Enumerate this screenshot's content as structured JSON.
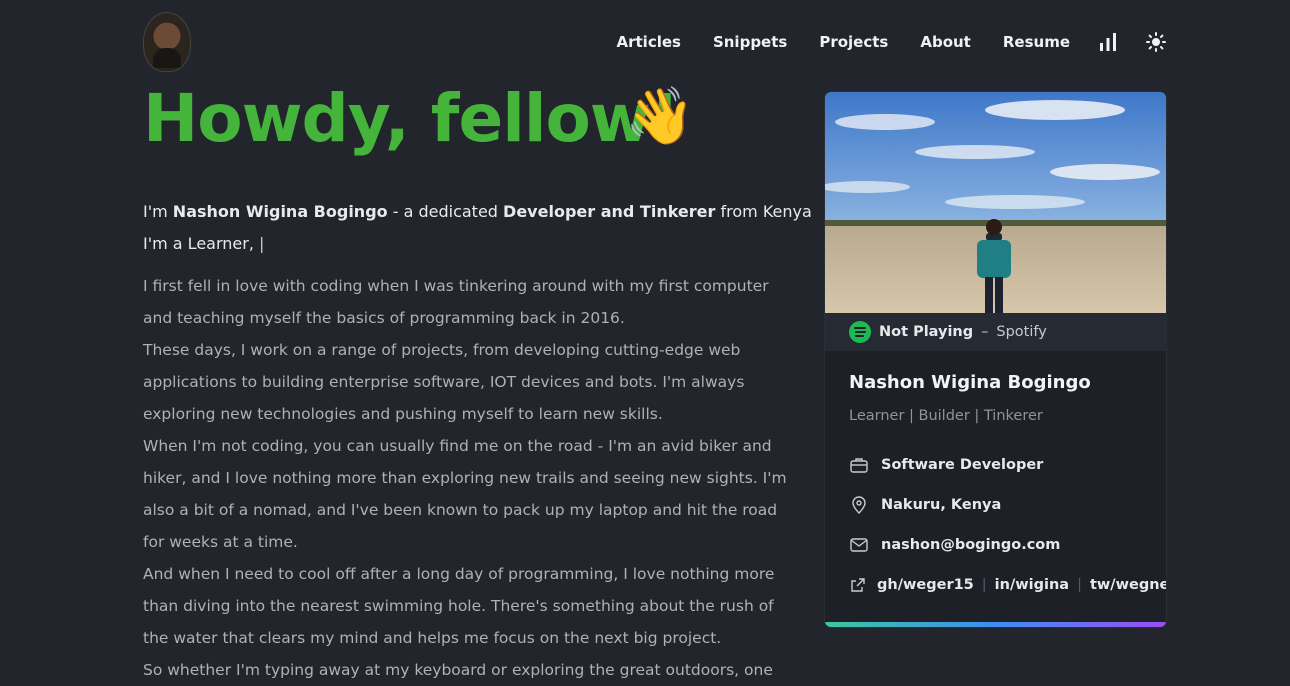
{
  "nav": {
    "items": [
      "Articles",
      "Snippets",
      "Projects",
      "About",
      "Resume"
    ]
  },
  "hero": {
    "title": "Howdy, fellow!",
    "wave": "👋"
  },
  "intro": {
    "line1_prefix": "I'm ",
    "name": "Nashon Wigina Bogingo",
    "line1_mid": " - a dedicated ",
    "roles": "Developer and Tinkerer",
    "line1_suffix": " from Kenya",
    "line2": "I'm a Learner, ",
    "cursor": "|"
  },
  "body": {
    "paragraphs": [
      "I first fell in love with coding when I was tinkering around with my first computer and teaching myself the basics of programming back in 2016.",
      "These days, I work on a range of projects, from developing cutting-edge web applications to building enterprise software, IOT devices and bots. I'm always exploring new technologies and pushing myself to learn new skills.",
      "When I'm not coding, you can usually find me on the road - I'm an avid biker and hiker, and I love nothing more than exploring new trails and seeing new sights. I'm also a bit of a nomad, and I've been known to pack up my laptop and hit the road for weeks at a time.",
      "And when I need to cool off after a long day of programming, I love nothing more than diving into the nearest swimming hole. There's something about the rush of the water that clears my mind and helps me focus on the next big project.",
      "So whether I'm typing away at my keyboard or exploring the great outdoors, one"
    ]
  },
  "card": {
    "spotify_status": "Not Playing",
    "spotify_dash": "–",
    "spotify_label": "Spotify",
    "name": "Nashon Wigina Bogingo",
    "tagline": "Learner | Builder | Tinkerer",
    "job": "Software Developer",
    "location": "Nakuru, Kenya",
    "email": "nashon@bogingo.com",
    "links": [
      "gh/weger15",
      "in/wigina",
      "tw/wegner"
    ],
    "link_separator": "|"
  },
  "colors": {
    "background": "#22252b",
    "title_green": "#45b43b",
    "spotify_green": "#1db954"
  }
}
